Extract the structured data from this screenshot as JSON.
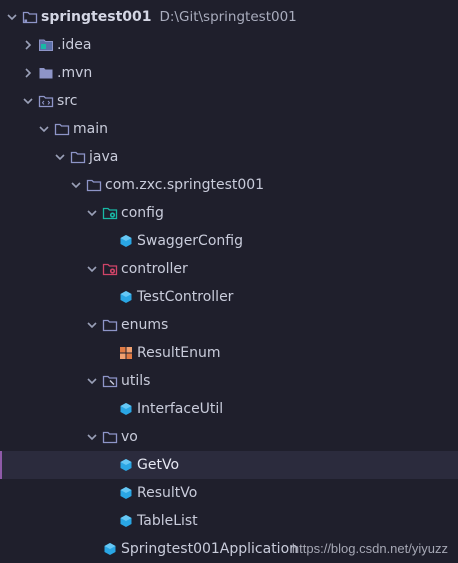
{
  "project": {
    "name": "springtest001",
    "path": "D:\\Git\\springtest001"
  },
  "items": [
    {
      "label": ".idea"
    },
    {
      "label": ".mvn"
    },
    {
      "label": "src"
    },
    {
      "label": "main"
    },
    {
      "label": "java"
    },
    {
      "label": "com.zxc.springtest001"
    },
    {
      "label": "config"
    },
    {
      "label": "SwaggerConfig"
    },
    {
      "label": "controller"
    },
    {
      "label": "TestController"
    },
    {
      "label": "enums"
    },
    {
      "label": "ResultEnum"
    },
    {
      "label": "utils"
    },
    {
      "label": "InterfaceUtil"
    },
    {
      "label": "vo"
    },
    {
      "label": "GetVo"
    },
    {
      "label": "ResultVo"
    },
    {
      "label": "TableList"
    },
    {
      "label": "Springtest001Application"
    }
  ],
  "selected": "GetVo",
  "watermark": "https://blog.csdn.net/yiyuzz",
  "colors": {
    "background": "#1f1f2c",
    "selected_row": "#2b2b3d",
    "selection_marker": "#8e5aa8",
    "folder": "#8e95c8",
    "java_class": "#2aa6e4",
    "enum": "#e07b45",
    "config_badge": "#19b8a5",
    "controller_badge": "#cf4468"
  },
  "icons": {
    "arrow_open": "chevron-down-icon",
    "arrow_closed": "chevron-right-icon",
    "folder": "folder-icon",
    "class": "java-class-icon",
    "enum": "enum-icon"
  }
}
